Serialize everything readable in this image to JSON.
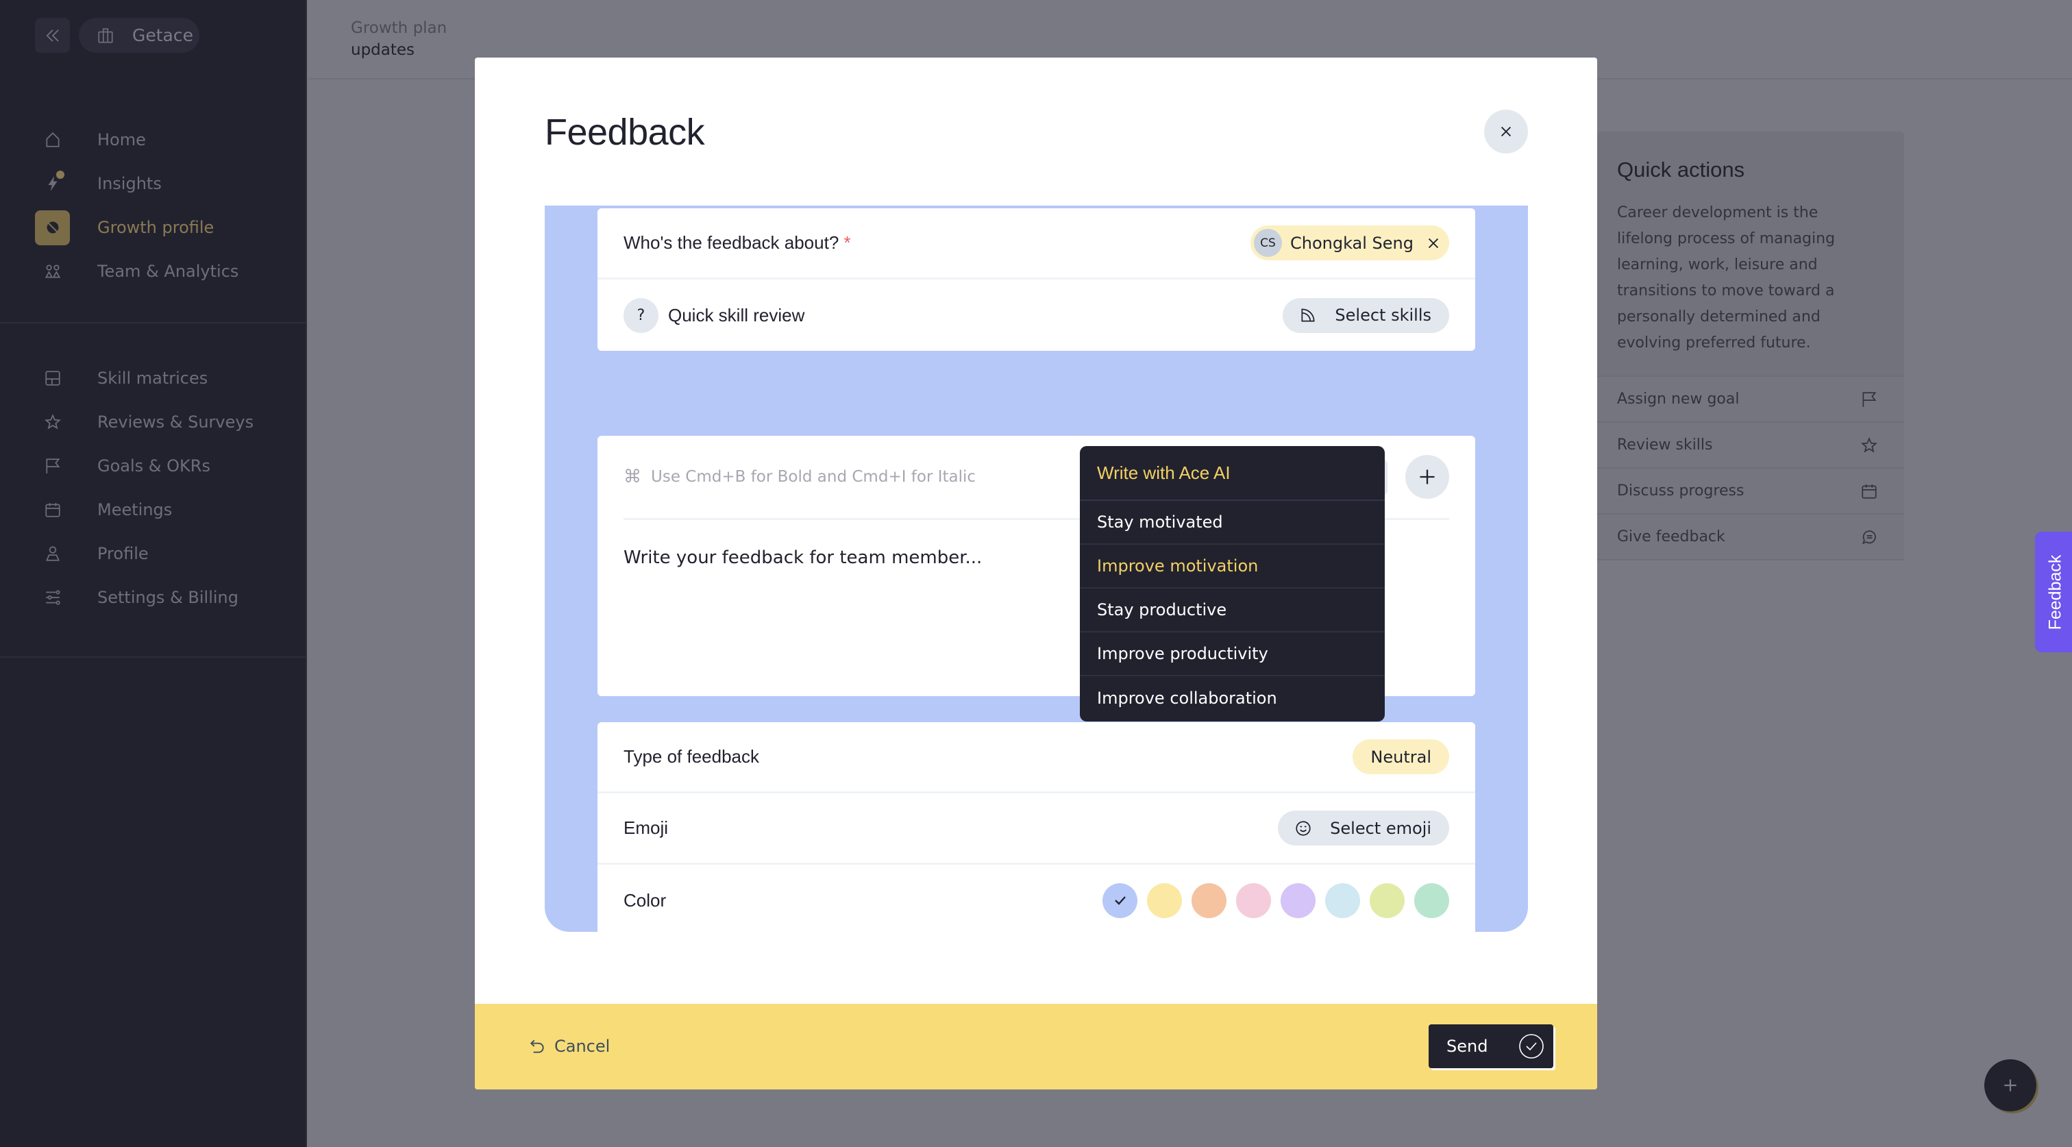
{
  "sidebar": {
    "org_name": "Getace",
    "primary_items": [
      {
        "label": "Home",
        "icon": "home-icon"
      },
      {
        "label": "Insights",
        "icon": "lightning-icon",
        "has_notification": true
      },
      {
        "label": "Growth profile",
        "icon": "leaf-icon",
        "active": true
      },
      {
        "label": "Team & Analytics",
        "icon": "team-icon"
      }
    ],
    "secondary_items": [
      {
        "label": "Skill matrices",
        "icon": "matrix-icon"
      },
      {
        "label": "Reviews & Surveys",
        "icon": "star-icon"
      },
      {
        "label": "Goals & OKRs",
        "icon": "flag-icon"
      },
      {
        "label": "Meetings",
        "icon": "calendar-icon"
      },
      {
        "label": "Profile",
        "icon": "user-icon"
      },
      {
        "label": "Settings & Billing",
        "icon": "sliders-icon"
      }
    ]
  },
  "header": {
    "breadcrumb": "Growth plan",
    "title": "updates"
  },
  "quick_actions": {
    "title": "Quick actions",
    "description": "Career development is the lifelong process of managing learning, work, leisure and transitions to move toward a personally determined and evolving preferred future.",
    "items": [
      {
        "label": "Assign new goal",
        "icon": "flag-icon"
      },
      {
        "label": "Review skills",
        "icon": "star-icon"
      },
      {
        "label": "Discuss progress",
        "icon": "calendar-icon"
      },
      {
        "label": "Give feedback",
        "icon": "chat-icon"
      }
    ]
  },
  "side_tab": {
    "label": "Feedback"
  },
  "modal": {
    "title": "Feedback",
    "about": {
      "label": "Who's the feedback about?",
      "required_mark": "*",
      "person": {
        "initials": "CS",
        "name": "Chongkal Seng"
      }
    },
    "quick_skill_review": {
      "icon_text": "?",
      "label": "Quick skill review",
      "button": "Select skills"
    },
    "editor": {
      "hint_icon": "⌘",
      "hint": "Use Cmd+B for Bold and Cmd+I for Italic",
      "ai_button": "Write with Ace AI",
      "placeholder": "Write your feedback for team member..."
    },
    "type": {
      "label": "Type of feedback",
      "value": "Neutral"
    },
    "emoji": {
      "label": "Emoji",
      "button": "Select emoji"
    },
    "color": {
      "label": "Color",
      "options": [
        "#b6c8f8",
        "#fbe9a3",
        "#f5c3a0",
        "#f5ccdb",
        "#d4c4f8",
        "#d0e8f2",
        "#e1eba6",
        "#b8e5ce"
      ],
      "selected_index": 0
    },
    "footer": {
      "cancel": "Cancel",
      "send": "Send"
    }
  },
  "ai_menu": {
    "title": "Write with Ace AI",
    "items": [
      {
        "label": "Stay motivated"
      },
      {
        "label": "Improve motivation",
        "highlighted": true
      },
      {
        "label": "Stay productive"
      },
      {
        "label": "Improve productivity"
      },
      {
        "label": "Improve collaboration"
      }
    ]
  },
  "colors": {
    "accent_blue": "#b6c8f8",
    "footer_yellow": "#f8dc78",
    "dark": "#22222f",
    "ai_highlight": "#f3d163",
    "side_tab": "#6d55ee"
  }
}
